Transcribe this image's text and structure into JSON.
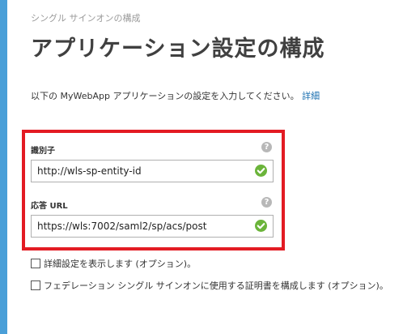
{
  "breadcrumb": "シングル サインオンの構成",
  "title": "アプリケーション設定の構成",
  "intro": {
    "text": "以下の MyWebApp アプリケーションの設定を入力してください。",
    "link": "詳細"
  },
  "fields": {
    "identifier": {
      "label": "識別子",
      "value": "http://wls-sp-entity-id"
    },
    "reply_url": {
      "label": "応答 URL",
      "value": "https://wls:7002/saml2/sp/acs/post"
    }
  },
  "help_glyph": "?",
  "options": {
    "advanced": "詳細設定を表示します (オプション)。",
    "certificate": "フェデレーション シングル サインオンに使用する証明書を構成します (オプション)。"
  },
  "colors": {
    "accent_bar": "#4a9fd8",
    "highlight": "#e31b23",
    "valid": "#6bb43a",
    "link": "#1a6fb0"
  },
  "icons": [
    "help-icon",
    "check-icon",
    "checkbox"
  ]
}
